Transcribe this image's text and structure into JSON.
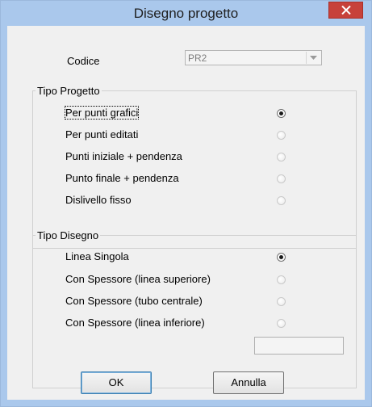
{
  "window": {
    "title": "Disegno progetto"
  },
  "codice": {
    "label": "Codice",
    "value": "PR2"
  },
  "tipo_progetto": {
    "legend": "Tipo Progetto",
    "options": [
      {
        "label": "Per punti grafici",
        "checked": true
      },
      {
        "label": "Per punti editati",
        "checked": false
      },
      {
        "label": "Punti iniziale + pendenza",
        "checked": false
      },
      {
        "label": "Punto finale + pendenza",
        "checked": false
      },
      {
        "label": "Dislivello fisso",
        "checked": false
      }
    ]
  },
  "tipo_disegno": {
    "legend": "Tipo Disegno",
    "options": [
      {
        "label": "Linea Singola",
        "checked": true
      },
      {
        "label": "Con Spessore (linea superiore)",
        "checked": false
      },
      {
        "label": "Con Spessore (tubo centrale)",
        "checked": false
      },
      {
        "label": "Con Spessore (linea inferiore)",
        "checked": false
      }
    ],
    "thickness_value": ""
  },
  "buttons": {
    "ok_mnemonic": "O",
    "ok_rest": "K",
    "cancel_mnemonic": "A",
    "cancel_rest": "nnulla"
  },
  "icons": {
    "close": "close-icon",
    "dropdown": "chevron-down-icon"
  },
  "colors": {
    "titlebar": "#aac8ec",
    "close_button": "#c7413a",
    "dialog_bg": "#f0f0f0"
  }
}
